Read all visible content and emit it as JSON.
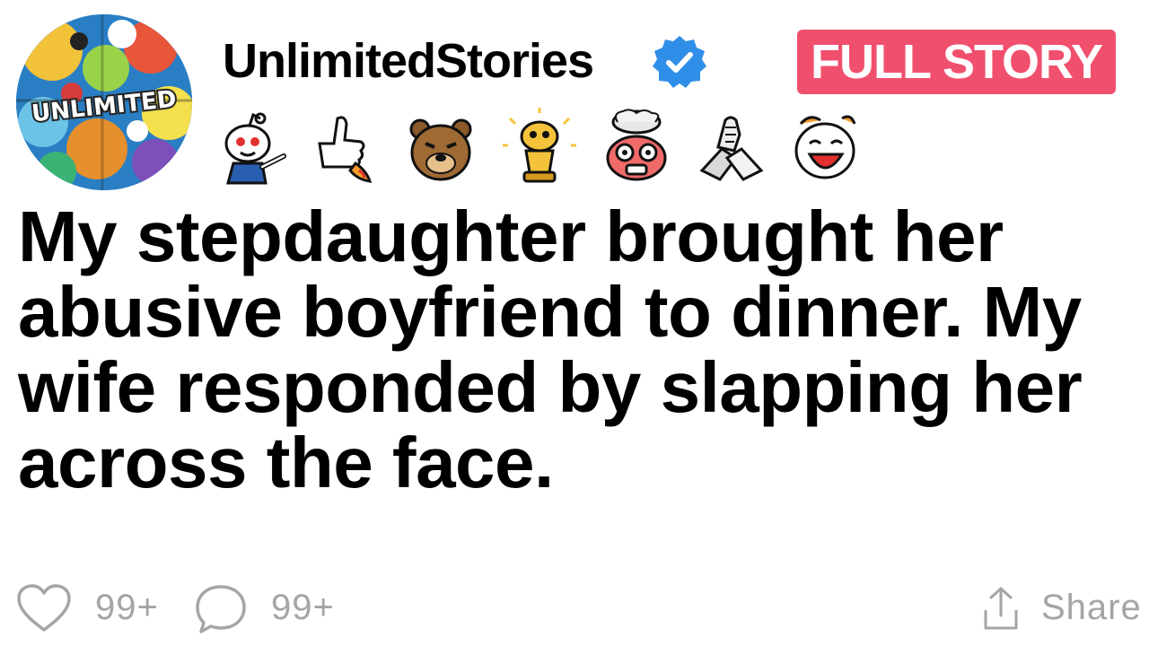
{
  "post": {
    "avatar_text": "UNLIMITED",
    "username": "UnlimitedStories",
    "verified_icon": "verified-badge-icon",
    "cta_label": "FULL STORY",
    "awards": [
      "pointing-snoo-award-icon",
      "rocket-thumbs-up-award-icon",
      "bear-award-icon",
      "gold-snoo-award-icon",
      "mind-blown-award-icon",
      "handshake-award-icon",
      "laughing-award-icon"
    ],
    "headline": "My stepdaughter brought her abusive boyfriend to dinner. My wife responded by slapping her across the face."
  },
  "footer": {
    "likes_count": "99+",
    "comments_count": "99+",
    "share_label": "Share"
  },
  "colors": {
    "cta_background": "#f0506e",
    "verified_blue": "#2f8fe8",
    "footer_gray": "#a5a5a5"
  }
}
